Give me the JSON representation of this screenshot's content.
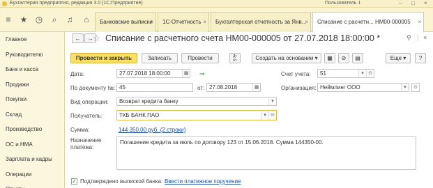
{
  "window": {
    "app_title": "Бухгалтерия предприятия, редакция 3.0  (1С:Предприятие)",
    "user": "Пользователь 1"
  },
  "tabs": [
    {
      "label": "Банковские выписки"
    },
    {
      "label": "1С-Отчетность"
    },
    {
      "label": "Бухгалтерская отчетность за Янв..."
    },
    {
      "label": "Списание с расчетн... НМ00-000005"
    }
  ],
  "sidebar": {
    "items": [
      {
        "label": "Главное"
      },
      {
        "label": "Руководителю"
      },
      {
        "label": "Банк и касса"
      },
      {
        "label": "Продажи"
      },
      {
        "label": "Покупки"
      },
      {
        "label": "Склад"
      },
      {
        "label": "Производство"
      },
      {
        "label": "ОС и НМА"
      },
      {
        "label": "Зарплата и кадры"
      },
      {
        "label": "Операции"
      },
      {
        "label": "Отчеты"
      }
    ]
  },
  "document": {
    "title": "Списание с расчетного счета НМ00-000005 от 27.07.2018 18:00:00 *"
  },
  "toolbar": {
    "post_close": "Провести и закрыть",
    "save": "Записать",
    "post": "Провести",
    "dt_kt": "Дт\nКт",
    "create_based": "Создать на основании",
    "more": "Еще",
    "help": "?"
  },
  "form": {
    "date_label": "Дата:",
    "date_value": "27.07.2018 18:00:00",
    "account_label": "Счет учета:",
    "account_value": "51",
    "doc_num_label": "По документу №:",
    "doc_num_value": "45",
    "doc_from_label": "от:",
    "doc_date_value": "27.08.2018",
    "org_label": "Организация:",
    "org_value": "Неймлинг ООО",
    "op_type_label": "Вид операции:",
    "op_type_value": "Возврат кредита банку",
    "recipient_label": "Получатель:",
    "recipient_value": "ТКБ БАНК ПАО",
    "sum_label": "Сумма:",
    "sum_value": "144 350,00 руб. (2 строки)",
    "purpose_label_1": "Назначение",
    "purpose_label_2": "платежа:",
    "purpose_value": "Погашение кредита за июль по договору 123 от 15.06.2018. Сумма 144350-00.",
    "confirmed_label": "Подтверждено выпиской банка:",
    "enter_order_link": "Ввести платежное поручение"
  },
  "icons": {
    "menu": "hamburger-icon",
    "favorites": "star-icon",
    "history": "clock-icon",
    "search": "search-icon",
    "notifications": "bell-icon",
    "home": "home-icon"
  },
  "colors": {
    "primary_button": "#fbdf63",
    "panel_bg": "#faf4d3",
    "link": "#1a4fa0"
  }
}
